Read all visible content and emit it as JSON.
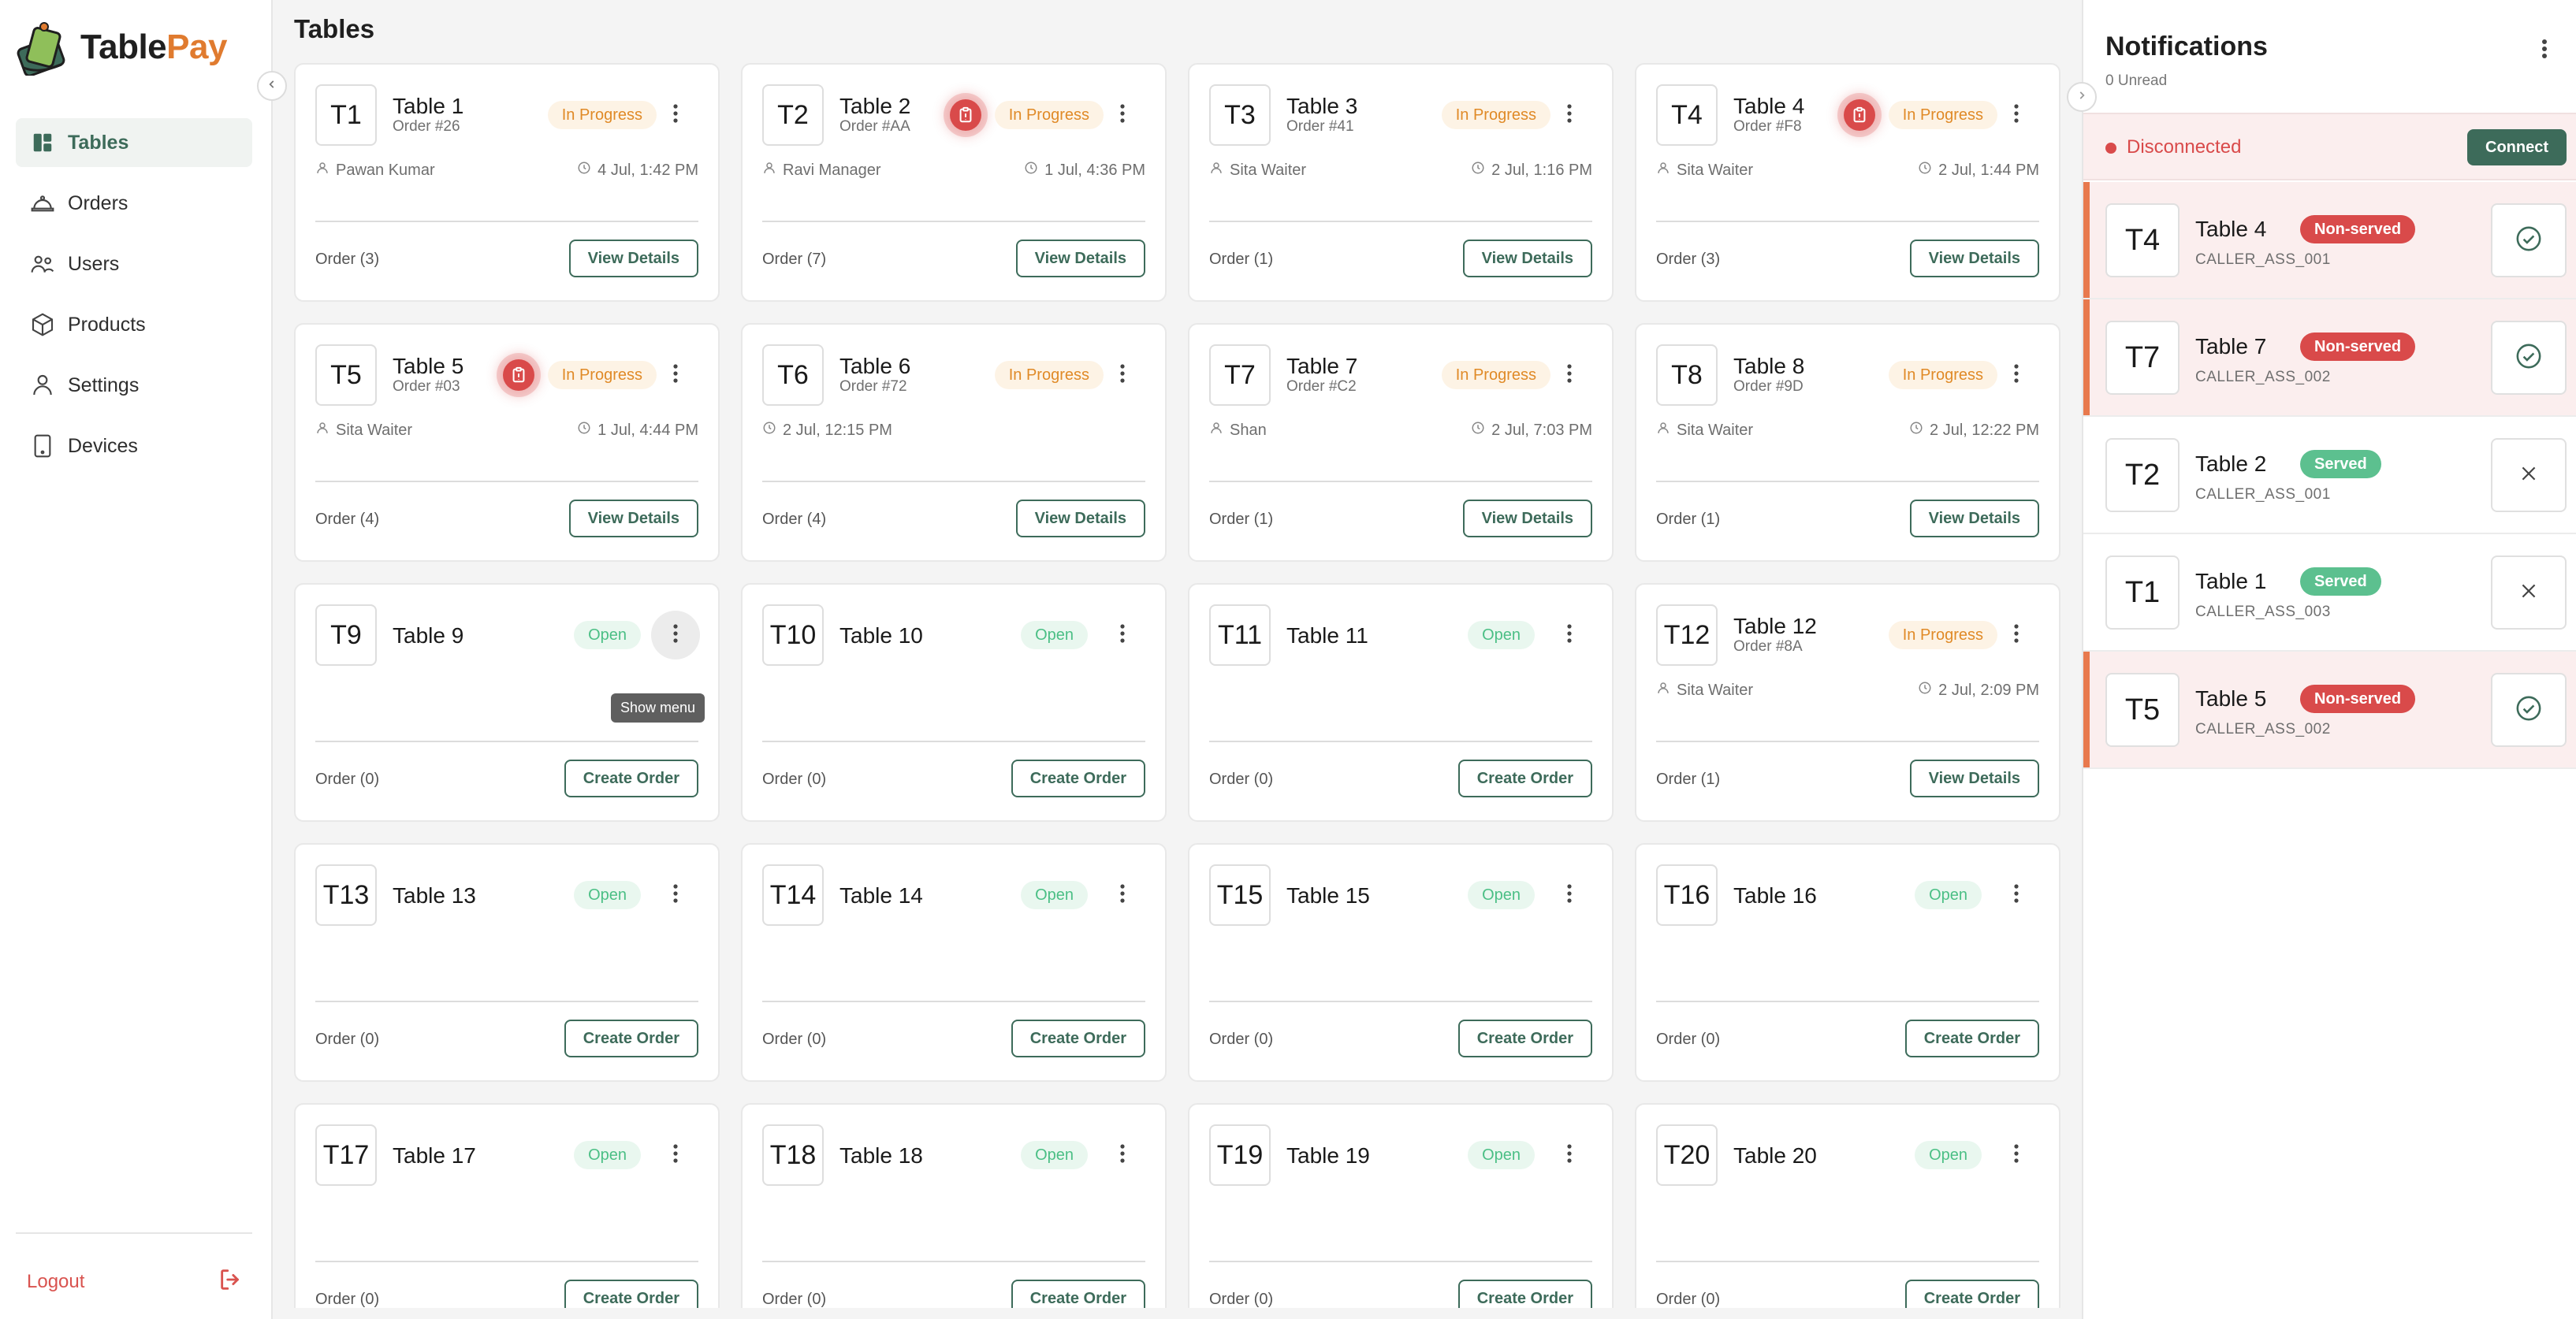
{
  "brand": {
    "name_part1": "Table",
    "name_part2": "Pay"
  },
  "sidebar": {
    "items": [
      {
        "label": "Tables",
        "icon": "layout-grid-icon",
        "active": true
      },
      {
        "label": "Orders",
        "icon": "cloche-icon",
        "active": false
      },
      {
        "label": "Users",
        "icon": "users-icon",
        "active": false
      },
      {
        "label": "Products",
        "icon": "box-icon",
        "active": false
      },
      {
        "label": "Settings",
        "icon": "user-gear-icon",
        "active": false
      },
      {
        "label": "Devices",
        "icon": "tablet-icon",
        "active": false
      }
    ],
    "logout_label": "Logout"
  },
  "page": {
    "title": "Tables"
  },
  "tables": [
    {
      "code": "T1",
      "name": "Table 1",
      "order_no": "Order #26",
      "status": "In Progress",
      "alert": false,
      "waiter": "Pawan Kumar",
      "time": "4 Jul, 1:42 PM",
      "order_count": "Order (3)",
      "action": "View Details"
    },
    {
      "code": "T2",
      "name": "Table 2",
      "order_no": "Order #AA",
      "status": "In Progress",
      "alert": true,
      "waiter": "Ravi Manager",
      "time": "1 Jul, 4:36 PM",
      "order_count": "Order (7)",
      "action": "View Details"
    },
    {
      "code": "T3",
      "name": "Table 3",
      "order_no": "Order #41",
      "status": "In Progress",
      "alert": false,
      "waiter": "Sita Waiter",
      "time": "2 Jul, 1:16 PM",
      "order_count": "Order (1)",
      "action": "View Details"
    },
    {
      "code": "T4",
      "name": "Table 4",
      "order_no": "Order #F8",
      "status": "In Progress",
      "alert": true,
      "waiter": "Sita Waiter",
      "time": "2 Jul, 1:44 PM",
      "order_count": "Order (3)",
      "action": "View Details"
    },
    {
      "code": "T5",
      "name": "Table 5",
      "order_no": "Order #03",
      "status": "In Progress",
      "alert": true,
      "waiter": "Sita Waiter",
      "time": "1 Jul, 4:44 PM",
      "order_count": "Order (4)",
      "action": "View Details"
    },
    {
      "code": "T6",
      "name": "Table 6",
      "order_no": "Order #72",
      "status": "In Progress",
      "alert": false,
      "waiter": "",
      "time": "2 Jul, 12:15 PM",
      "order_count": "Order (4)",
      "action": "View Details"
    },
    {
      "code": "T7",
      "name": "Table 7",
      "order_no": "Order #C2",
      "status": "In Progress",
      "alert": false,
      "waiter": "Shan",
      "time": "2 Jul, 7:03 PM",
      "order_count": "Order (1)",
      "action": "View Details"
    },
    {
      "code": "T8",
      "name": "Table 8",
      "order_no": "Order #9D",
      "status": "In Progress",
      "alert": false,
      "waiter": "Sita Waiter",
      "time": "2 Jul, 12:22 PM",
      "order_count": "Order (1)",
      "action": "View Details"
    },
    {
      "code": "T9",
      "name": "Table 9",
      "order_no": "",
      "status": "Open",
      "alert": false,
      "waiter": "",
      "time": "",
      "order_count": "Order (0)",
      "action": "Create Order",
      "menu_hover": true,
      "tooltip": "Show menu"
    },
    {
      "code": "T10",
      "name": "Table 10",
      "order_no": "",
      "status": "Open",
      "alert": false,
      "waiter": "",
      "time": "",
      "order_count": "Order (0)",
      "action": "Create Order"
    },
    {
      "code": "T11",
      "name": "Table 11",
      "order_no": "",
      "status": "Open",
      "alert": false,
      "waiter": "",
      "time": "",
      "order_count": "Order (0)",
      "action": "Create Order"
    },
    {
      "code": "T12",
      "name": "Table 12",
      "order_no": "Order #8A",
      "status": "In Progress",
      "alert": false,
      "waiter": "Sita Waiter",
      "time": "2 Jul, 2:09 PM",
      "order_count": "Order (1)",
      "action": "View Details"
    },
    {
      "code": "T13",
      "name": "Table 13",
      "order_no": "",
      "status": "Open",
      "alert": false,
      "waiter": "",
      "time": "",
      "order_count": "Order (0)",
      "action": "Create Order"
    },
    {
      "code": "T14",
      "name": "Table 14",
      "order_no": "",
      "status": "Open",
      "alert": false,
      "waiter": "",
      "time": "",
      "order_count": "Order (0)",
      "action": "Create Order"
    },
    {
      "code": "T15",
      "name": "Table 15",
      "order_no": "",
      "status": "Open",
      "alert": false,
      "waiter": "",
      "time": "",
      "order_count": "Order (0)",
      "action": "Create Order"
    },
    {
      "code": "T16",
      "name": "Table 16",
      "order_no": "",
      "status": "Open",
      "alert": false,
      "waiter": "",
      "time": "",
      "order_count": "Order (0)",
      "action": "Create Order"
    },
    {
      "code": "T17",
      "name": "Table 17",
      "order_no": "",
      "status": "Open",
      "alert": false,
      "waiter": "",
      "time": "",
      "order_count": "Order (0)",
      "action": "Create Order"
    },
    {
      "code": "T18",
      "name": "Table 18",
      "order_no": "",
      "status": "Open",
      "alert": false,
      "waiter": "",
      "time": "",
      "order_count": "Order (0)",
      "action": "Create Order"
    },
    {
      "code": "T19",
      "name": "Table 19",
      "order_no": "",
      "status": "Open",
      "alert": false,
      "waiter": "",
      "time": "",
      "order_count": "Order (0)",
      "action": "Create Order"
    },
    {
      "code": "T20",
      "name": "Table 20",
      "order_no": "",
      "status": "Open",
      "alert": false,
      "waiter": "",
      "time": "",
      "order_count": "Order (0)",
      "action": "Create Order"
    }
  ],
  "notifications": {
    "title": "Notifications",
    "unread": "0 Unread",
    "connection_status": "Disconnected",
    "connect_label": "Connect",
    "items": [
      {
        "code": "T4",
        "name": "Table 4",
        "status": "Non-served",
        "caller": "CALLER_ASS_001",
        "action_icon": "check-circle-icon"
      },
      {
        "code": "T7",
        "name": "Table 7",
        "status": "Non-served",
        "caller": "CALLER_ASS_002",
        "action_icon": "check-circle-icon"
      },
      {
        "code": "T2",
        "name": "Table 2",
        "status": "Served",
        "caller": "CALLER_ASS_001",
        "action_icon": "close-icon"
      },
      {
        "code": "T1",
        "name": "Table 1",
        "status": "Served",
        "caller": "CALLER_ASS_003",
        "action_icon": "close-icon"
      },
      {
        "code": "T5",
        "name": "Table 5",
        "status": "Non-served",
        "caller": "CALLER_ASS_002",
        "action_icon": "check-circle-icon"
      }
    ]
  },
  "colors": {
    "accent": "#3d6b5a",
    "brand_orange": "#e07b2f",
    "in_progress_text": "#e08a27",
    "open_text": "#4bbf85",
    "alert_red": "#d94a4a",
    "served_green": "#5cc08f"
  }
}
